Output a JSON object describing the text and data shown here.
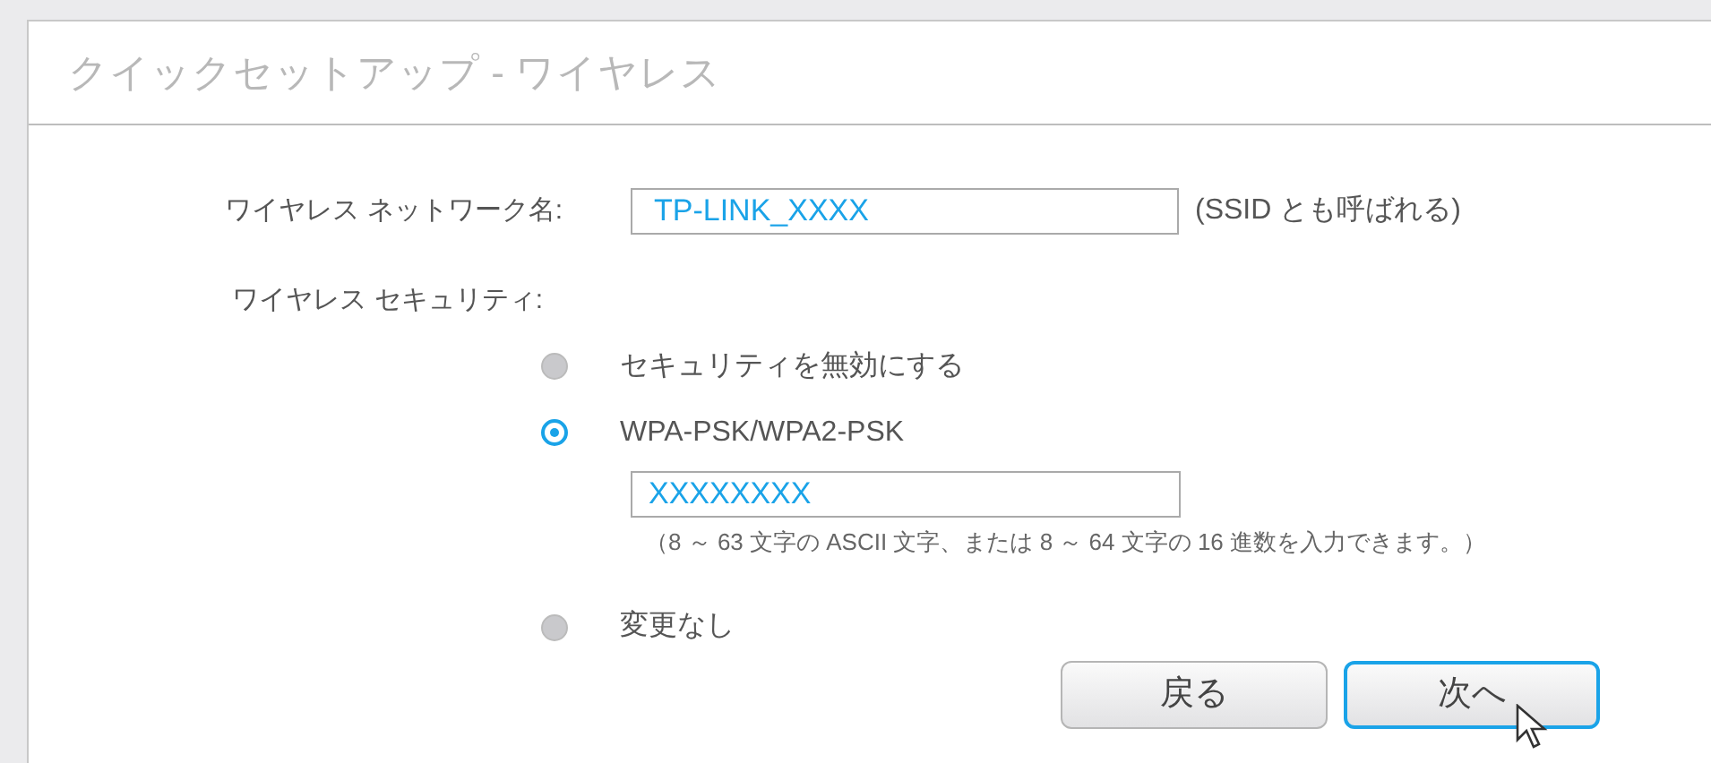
{
  "panel": {
    "title": "クイックセットアップ - ワイヤレス"
  },
  "ssid": {
    "label": "ワイヤレス ネットワーク名:",
    "value": "TP-LINK_XXXX",
    "hint": "(SSID とも呼ばれる)"
  },
  "security": {
    "label": "ワイヤレス セキュリティ:",
    "options": [
      {
        "label": "セキュリティを無効にする",
        "selected": false
      },
      {
        "label": "WPA-PSK/WPA2-PSK",
        "selected": true,
        "password": "XXXXXXXX",
        "note": "（8 ～ 63 文字の ASCII 文字、または 8 ～ 64 文字の 16 進数を入力できます。）"
      },
      {
        "label": "変更なし",
        "selected": false
      }
    ]
  },
  "buttons": [
    {
      "label": "戻る",
      "focused": false
    },
    {
      "label": "次へ",
      "focused": true,
      "pointer": true
    }
  ]
}
